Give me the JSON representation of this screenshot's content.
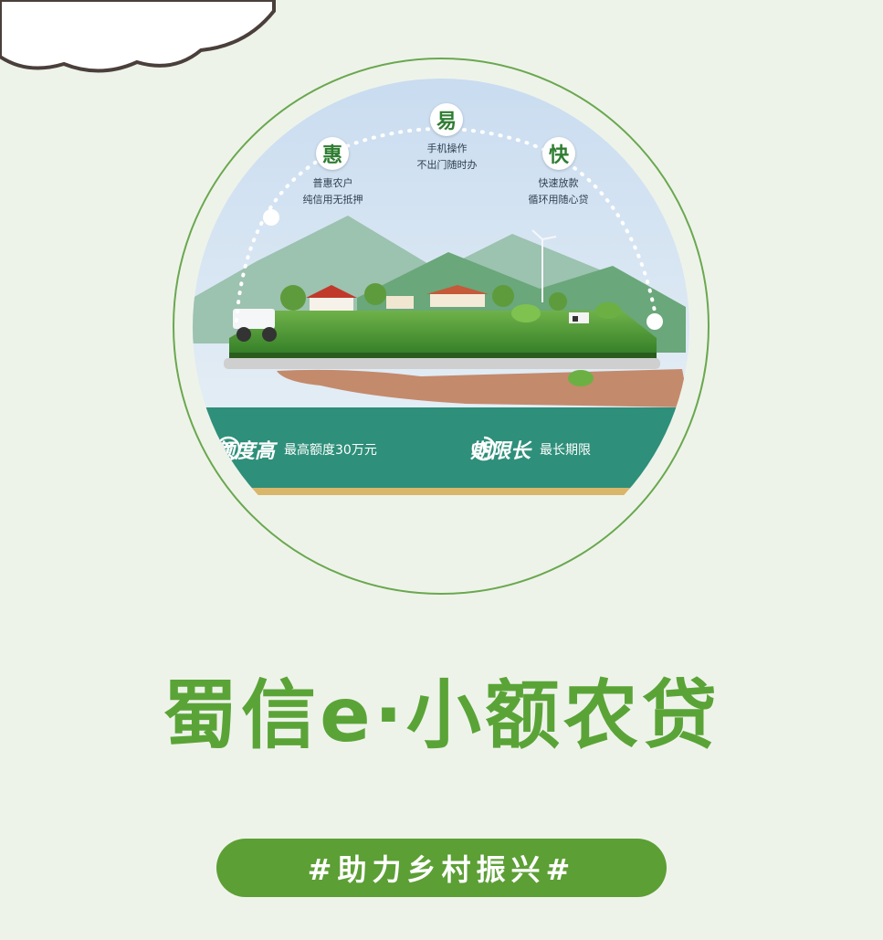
{
  "hero": {
    "badges": [
      {
        "char": "惠",
        "line1": "普惠农户",
        "line2": "纯信用无抵押"
      },
      {
        "char": "易",
        "line1": "手机操作",
        "line2": "不出门随时办"
      },
      {
        "char": "快",
        "line1": "快速放款",
        "line2": "循环用随心贷"
      }
    ],
    "features": [
      {
        "title": "额度高",
        "desc": "最高额度30万元",
        "icon": "yen-coin-icon"
      },
      {
        "title": "期限长",
        "desc": "最长期限",
        "icon": "clock-refresh-icon"
      }
    ]
  },
  "title": "蜀信e·小额农贷",
  "slogan": "#助力乡村振兴#",
  "colors": {
    "background": "#eef3ea",
    "brand_green": "#5aa437",
    "slogan_bg": "#5c9f35",
    "teal_band": "#2e8f7a"
  }
}
